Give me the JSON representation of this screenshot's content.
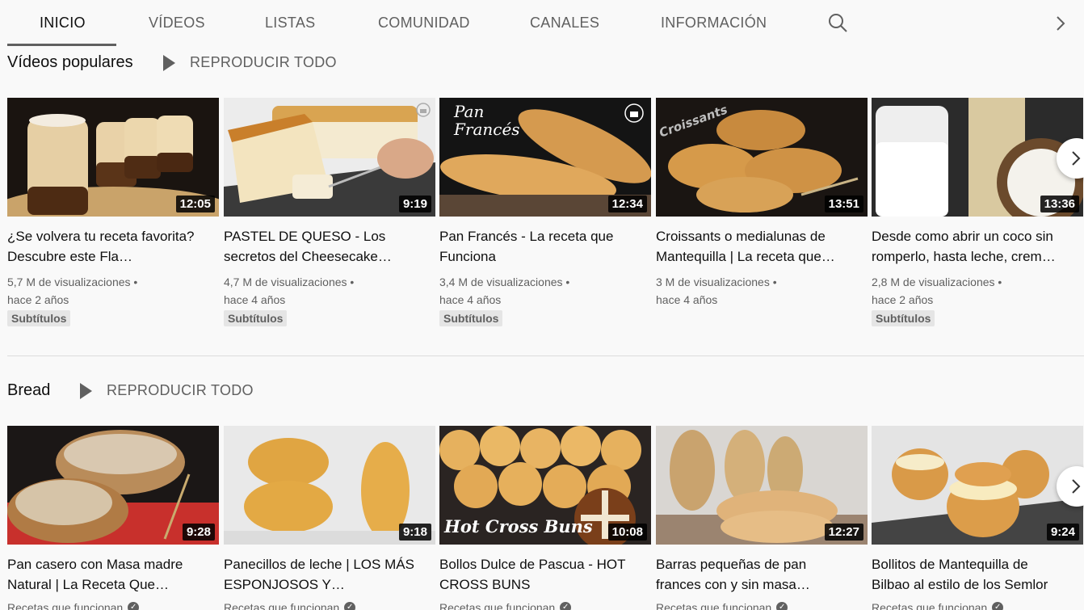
{
  "tabs": [
    {
      "label": "INICIO"
    },
    {
      "label": "VÍDEOS"
    },
    {
      "label": "LISTAS"
    },
    {
      "label": "COMUNIDAD"
    },
    {
      "label": "CANALES"
    },
    {
      "label": "INFORMACIÓN"
    }
  ],
  "shelves": [
    {
      "title": "Vídeos populares",
      "play_all": "REPRODUCIR TODO",
      "videos": [
        {
          "title": "¿Se volvera tu receta favorita? Descubre este Fla…",
          "duration": "12:05",
          "views": "5,7 M de visualizaciones",
          "age": "hace 2 años",
          "badge": "Subtítulos",
          "thumb": "flan-jars"
        },
        {
          "title": "PASTEL DE QUESO - Los secretos del Cheesecake…",
          "duration": "9:19",
          "views": "4,7 M de visualizaciones",
          "age": "hace 4 años",
          "badge": "Subtítulos",
          "thumb": "cheesecake"
        },
        {
          "title": "Pan Francés - La receta que Funciona",
          "duration": "12:34",
          "views": "3,4 M de visualizaciones",
          "age": "hace 4 años",
          "badge": "Subtítulos",
          "thumb": "baguettes",
          "overlay_text": "Pan Francés"
        },
        {
          "title": "Croissants o medialunas de Mantequilla | La receta que…",
          "duration": "13:51",
          "views": "3 M de visualizaciones",
          "age": "hace 4 años",
          "badge": "",
          "thumb": "croissants",
          "overlay_text": "Croissants"
        },
        {
          "title": "Desde como abrir un coco sin romperlo, hasta leche, crem…",
          "duration": "13:36",
          "views": "2,8 M de visualizaciones",
          "age": "hace 2 años",
          "badge": "Subtítulos",
          "thumb": "coconut-milk"
        }
      ]
    },
    {
      "title": "Bread",
      "play_all": "REPRODUCIR TODO",
      "videos": [
        {
          "title": "Pan casero con Masa madre Natural | La Receta Que…",
          "duration": "9:28",
          "channel": "Recetas que funcionan",
          "thumb": "sourdough"
        },
        {
          "title": "Panecillos de leche | LOS MÁS ESPONJOSOS Y…",
          "duration": "9:18",
          "channel": "Recetas que funcionan",
          "thumb": "milk-rolls"
        },
        {
          "title": "Bollos Dulce de Pascua - HOT CROSS BUNS",
          "duration": "10:08",
          "channel": "Recetas que funcionan",
          "thumb": "hot-cross-buns",
          "overlay_text": "Hot Cross Buns"
        },
        {
          "title": "Barras pequeñas de pan frances con y sin masa…",
          "duration": "12:27",
          "channel": "Recetas que funcionan",
          "thumb": "small-baguettes"
        },
        {
          "title": "Bollitos de Mantequilla de Bilbao al estilo de los Semlor",
          "duration": "9:24",
          "channel": "Recetas que funcionan",
          "thumb": "semlor"
        }
      ]
    }
  ],
  "icons": {
    "search": "search-icon",
    "next": "chevron-right-icon",
    "play": "play-icon",
    "verified": "verified-check-icon"
  },
  "colors": {
    "background": "#f9f9f9",
    "text_primary": "#0f0f0f",
    "text_secondary": "#606060",
    "badge_bg": "#e5e5e5",
    "duration_bg": "#000000"
  }
}
